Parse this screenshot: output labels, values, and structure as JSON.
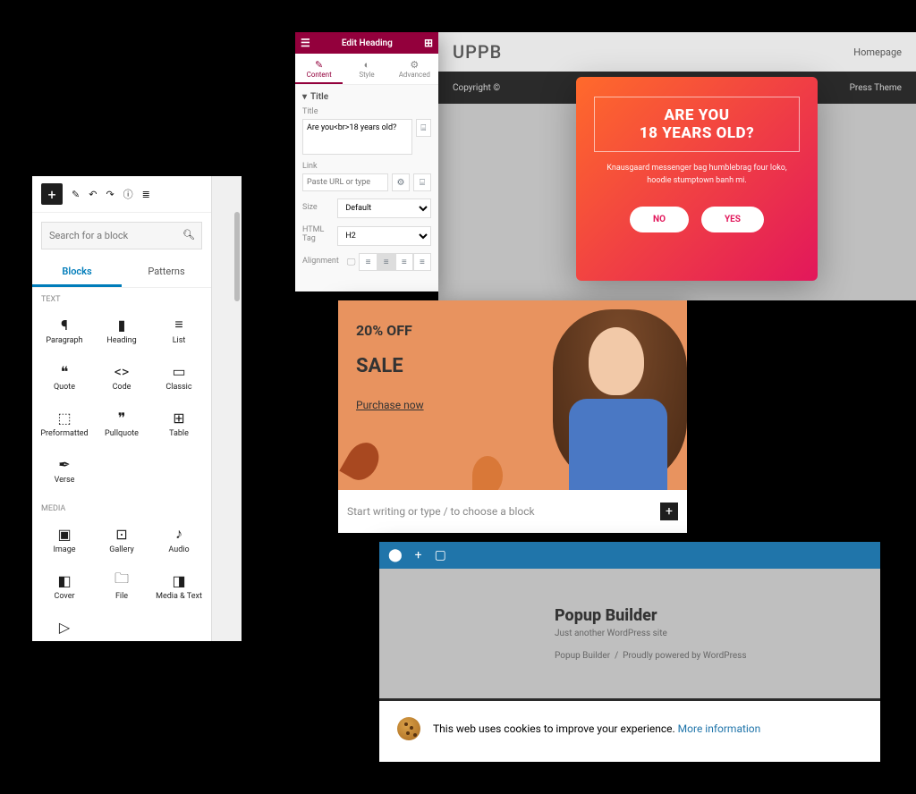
{
  "gutenberg": {
    "search_placeholder": "Search for a block",
    "tabs": {
      "blocks": "Blocks",
      "patterns": "Patterns"
    },
    "section_text": "TEXT",
    "section_media": "MEDIA",
    "blocks_text": [
      {
        "icon": "¶",
        "label": "Paragraph"
      },
      {
        "icon": "▮",
        "label": "Heading"
      },
      {
        "icon": "≡",
        "label": "List"
      },
      {
        "icon": "❝",
        "label": "Quote"
      },
      {
        "icon": "<>",
        "label": "Code"
      },
      {
        "icon": "▭",
        "label": "Classic"
      },
      {
        "icon": "⬚",
        "label": "Preformatted"
      },
      {
        "icon": "❞",
        "label": "Pullquote"
      },
      {
        "icon": "⊞",
        "label": "Table"
      },
      {
        "icon": "✒",
        "label": "Verse"
      }
    ],
    "blocks_media": [
      {
        "icon": "▣",
        "label": "Image"
      },
      {
        "icon": "⊡",
        "label": "Gallery"
      },
      {
        "icon": "♪",
        "label": "Audio"
      },
      {
        "icon": "◧",
        "label": "Cover"
      },
      {
        "icon": "🗀",
        "label": "File"
      },
      {
        "icon": "◨",
        "label": "Media & Text"
      },
      {
        "icon": "▷",
        "label": ""
      }
    ]
  },
  "elementor": {
    "header": "Edit Heading",
    "tabs": {
      "content": "Content",
      "style": "Style",
      "advanced": "Advanced"
    },
    "title_section": "Title",
    "title_label": "Title",
    "title_value": "Are you<br>18 years old?",
    "link_label": "Link",
    "link_placeholder": "Paste URL or type",
    "size_label": "Size",
    "size_value": "Default",
    "tag_label": "HTML Tag",
    "tag_value": "H2",
    "align_label": "Alignment"
  },
  "uppb": {
    "brand": "UPPB",
    "homepage": "Homepage",
    "copyright_left": "Copyright ©",
    "copyright_right": "Press Theme",
    "popup": {
      "line1": "ARE YOU",
      "line2": "18 YEARS OLD?",
      "sub": "Knausgaard messenger bag humblebrag four loko, hoodie stumptown banh mi.",
      "no": "NO",
      "yes": "YES"
    }
  },
  "sale": {
    "off": "20% OFF",
    "sale": "SALE",
    "cta": "Purchase now",
    "placeholder": "Start writing or type / to choose a block"
  },
  "cookie": {
    "title": "Popup Builder",
    "tagline": "Just another WordPress site",
    "footer_left": "Popup Builder",
    "footer_right": "Proudly powered by WordPress",
    "text": "This web uses cookies to improve your experience.",
    "link": "More information"
  }
}
